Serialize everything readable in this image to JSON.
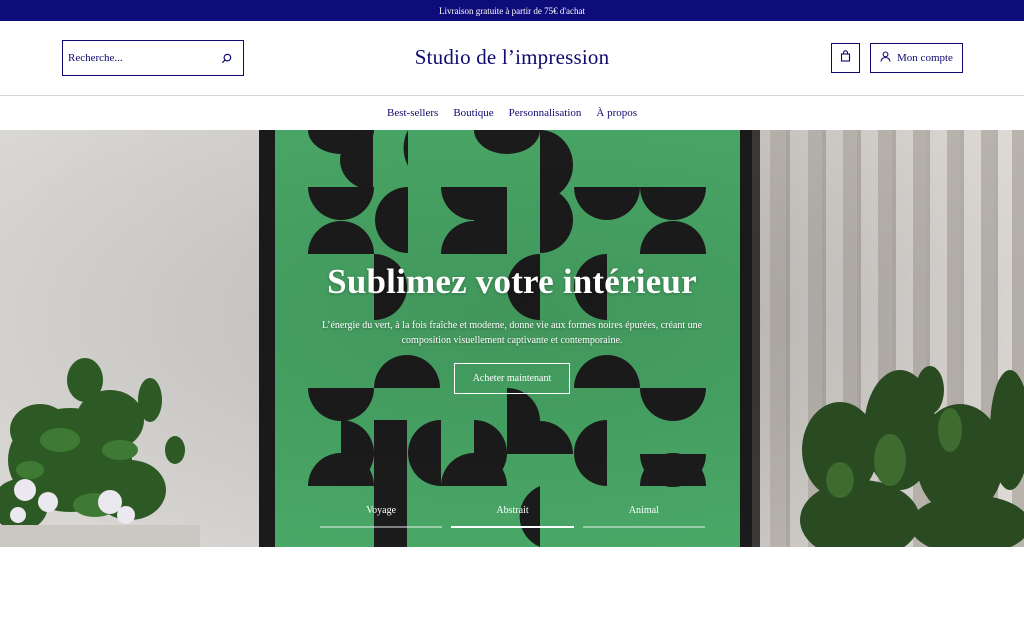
{
  "announcement": "Livraison gratuite à partir de 75€ d'achat",
  "header": {
    "search_placeholder": "Recherche...",
    "brand": "Studio de l’impression",
    "account_label": "Mon compte"
  },
  "nav": {
    "items": [
      {
        "label": "Best-sellers"
      },
      {
        "label": "Boutique"
      },
      {
        "label": "Personnalisation"
      },
      {
        "label": "À propos"
      }
    ]
  },
  "hero": {
    "title": "Sublimez votre intérieur",
    "description": "L’énergie du vert, à la fois fraîche et moderne, donne vie aux formes noires épurées, créant une composition visuellement captivante et contemporaine.",
    "cta": "Acheter maintenant",
    "slides": [
      {
        "label": "Voyage",
        "active": false
      },
      {
        "label": "Abstrait",
        "active": true
      },
      {
        "label": "Animal",
        "active": false
      }
    ]
  },
  "colors": {
    "brand_navy": "#0f0a6e",
    "announcement_bg": "#0e0b7a",
    "poster_green": "#4aaa68"
  },
  "icons": {
    "search": "search-icon",
    "cart": "shopping-bag-icon",
    "account": "user-icon"
  }
}
